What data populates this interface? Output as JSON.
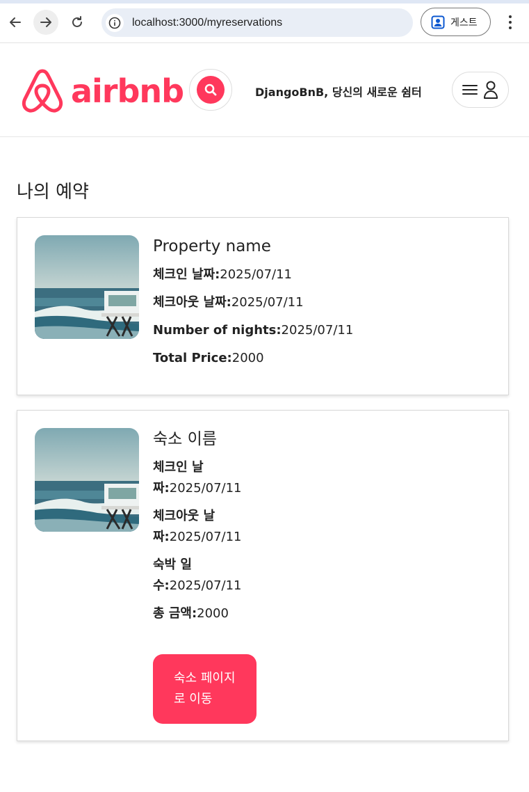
{
  "browser": {
    "url": "localhost:3000/myreservations",
    "profile_label": "게스트"
  },
  "header": {
    "logo_text": "airbnb",
    "tagline": "DjangoBnB, 당신의 새로운 쉼터"
  },
  "page": {
    "title": "나의 예약"
  },
  "reservations": [
    {
      "property_name": "Property name",
      "checkin_label": "체크인 날짜:",
      "checkin_value": "2025/07/11",
      "checkout_label": "체크아웃 날짜:",
      "checkout_value": "2025/07/11",
      "nights_label": "Number of nights:",
      "nights_value": "2025/07/11",
      "total_label": "Total Price:",
      "total_value": "2000"
    },
    {
      "property_name": "숙소 이름",
      "checkin_label": "체크인 날짜:",
      "checkin_value": "2025/07/11",
      "checkout_label": "체크아웃 날짜:",
      "checkout_value": "2025/07/11",
      "nights_label": "숙박 일수:",
      "nights_value": "2025/07/11",
      "total_label": "총 금액:",
      "total_value": "2000",
      "button_label": "숙소 페이지로 이동"
    }
  ],
  "colors": {
    "brand": "#ff385c",
    "omnibox": "#e9eef6"
  }
}
